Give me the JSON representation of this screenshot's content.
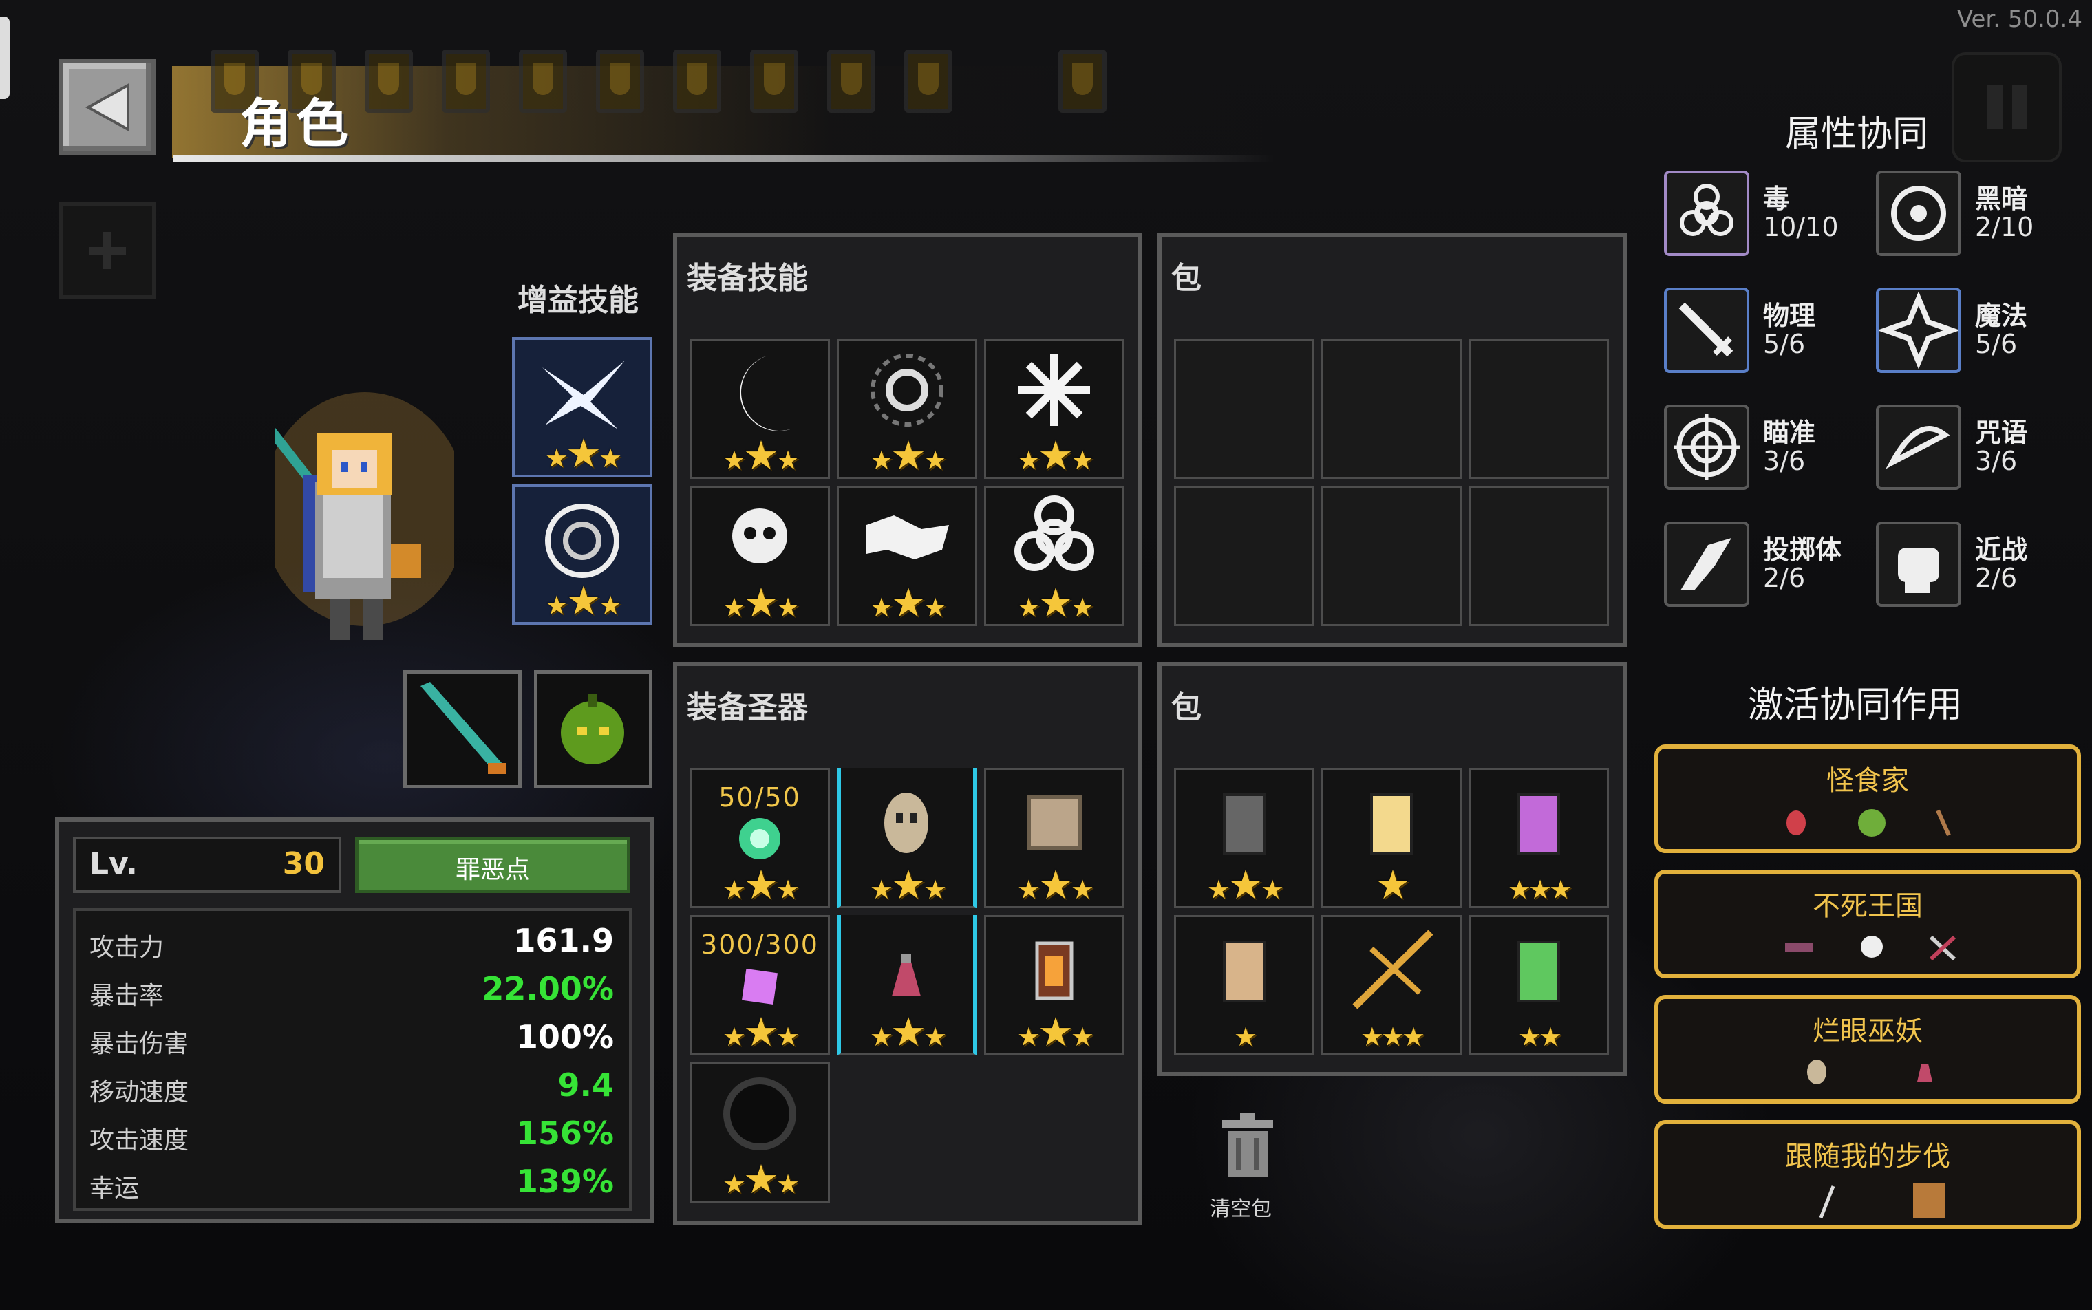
{
  "version": "Ver. 50.0.4",
  "title": "角色",
  "buff_skills_label": "增益技能",
  "equip_skills": {
    "title": "装备技能",
    "slots": [
      {
        "icon": "crescent-moon-icon",
        "stars": 3
      },
      {
        "icon": "biohazard-burst-icon",
        "stars": 3
      },
      {
        "icon": "spark-burst-icon",
        "stars": 3
      },
      {
        "icon": "skull-explosion-icon",
        "stars": 3
      },
      {
        "icon": "chain-shuriken-icon",
        "stars": 3
      },
      {
        "icon": "biohazard-icon",
        "stars": 3
      }
    ]
  },
  "skill_bag": {
    "title": "包"
  },
  "equip_relics": {
    "title": "装备圣器",
    "slots": [
      {
        "icon": "green-orb-icon",
        "stars": 3,
        "count": "50/50"
      },
      {
        "icon": "skull-mask-icon",
        "stars": 3,
        "count": ""
      },
      {
        "icon": "stone-cube-icon",
        "stars": 3,
        "count": ""
      },
      {
        "icon": "purple-gem-icon",
        "stars": 3,
        "count": "300/300"
      },
      {
        "icon": "potion-flask-icon",
        "stars": 3,
        "count": ""
      },
      {
        "icon": "lantern-icon",
        "stars": 3,
        "count": ""
      },
      {
        "icon": "dark-vortex-icon",
        "stars": 3,
        "count": ""
      }
    ]
  },
  "relic_bag": {
    "title": "包",
    "slots": [
      {
        "icon": "gray-scroll-icon",
        "stars": 3
      },
      {
        "icon": "yellow-scroll-icon",
        "stars": 1
      },
      {
        "icon": "purple-scroll-icon",
        "stars": 3
      },
      {
        "icon": "tan-scroll-icon",
        "stars": 1
      },
      {
        "icon": "golden-spear-icon",
        "stars": 3
      },
      {
        "icon": "green-scroll-icon",
        "stars": 2
      }
    ]
  },
  "clear_bag_label": "清空包",
  "level": {
    "label": "Lv.",
    "value": "30"
  },
  "sin_points_button": "罪恶点",
  "stats": [
    {
      "label": "攻击力",
      "value": "161.9",
      "color": "#ffffff"
    },
    {
      "label": "暴击率",
      "value": "22.00%",
      "color": "#36e336"
    },
    {
      "label": "暴击伤害",
      "value": "100%",
      "color": "#ffffff"
    },
    {
      "label": "移动速度",
      "value": "9.4",
      "color": "#36e336"
    },
    {
      "label": "攻击速度",
      "value": "156%",
      "color": "#36e336"
    },
    {
      "label": "幸运",
      "value": "139%",
      "color": "#36e336"
    }
  ],
  "synergy_title": "属性协同",
  "synergies": [
    {
      "name": "毒",
      "count": "10/10",
      "icon": "biohazard-icon"
    },
    {
      "name": "黑暗",
      "count": "2/10",
      "icon": "dark-eye-icon"
    },
    {
      "name": "物理",
      "count": "5/6",
      "icon": "sword-icon"
    },
    {
      "name": "魔法",
      "count": "5/6",
      "icon": "magic-star-icon"
    },
    {
      "name": "瞄准",
      "count": "3/6",
      "icon": "crosshair-icon"
    },
    {
      "name": "咒语",
      "count": "3/6",
      "icon": "rune-icon"
    },
    {
      "name": "投掷体",
      "count": "2/6",
      "icon": "throw-icon"
    },
    {
      "name": "近战",
      "count": "2/6",
      "icon": "fist-icon"
    }
  ],
  "active_title": "激活协同作用",
  "active_synergies": [
    {
      "name": "怪食家"
    },
    {
      "name": "不死王国"
    },
    {
      "name": "烂眼巫妖"
    },
    {
      "name": "跟随我的步伐"
    }
  ],
  "colors": {
    "gold": "#f5c63a",
    "green": "#36e336",
    "panel_border": "#5a5a5a",
    "active_border": "#e2b13c"
  }
}
